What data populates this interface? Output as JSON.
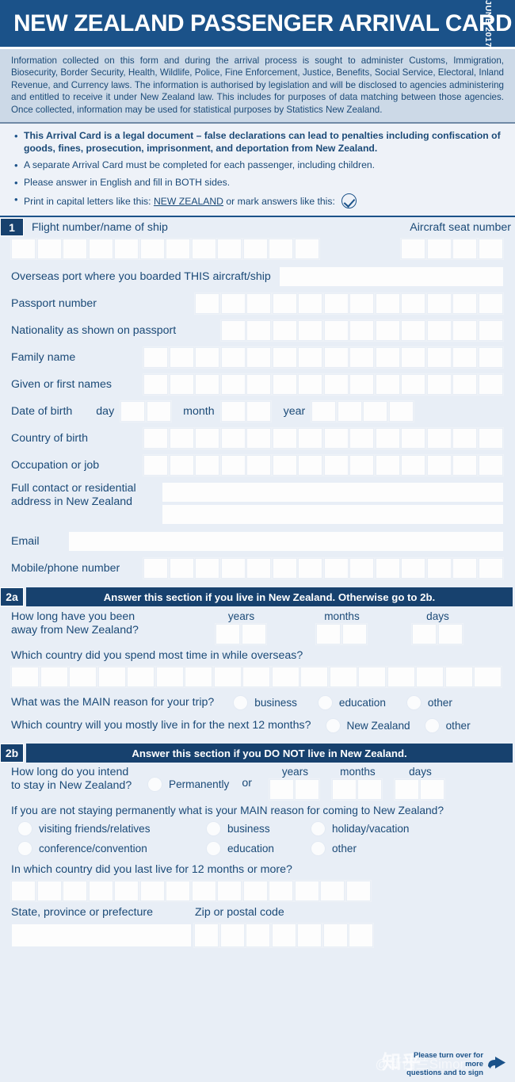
{
  "header": {
    "title": "NEW ZEALAND PASSENGER ARRIVAL CARD",
    "date": "JUNE 2017",
    "bg_color": "#1b5289"
  },
  "intro": {
    "text": "Information collected on this form and during the arrival process is sought to administer Customs, Immigration, Biosecurity, Border Security, Health, Wildlife, Police, Fine Enforcement, Justice, Benefits, Social Service, Electoral, Inland Revenue, and Currency laws. The information is authorised by legislation and will be disclosed to agencies administering and entitled to receive it under New Zealand law. This includes for purposes of data matching between those agencies. Once collected, information may be used for statistical purposes by Statistics New Zealand."
  },
  "bullets": [
    {
      "text": "This Arrival Card is a legal document – false declarations can lead to penalties including confiscation of goods, fines, prosecution, imprisonment, and deportation from New Zealand.",
      "bold": true
    },
    {
      "text": "A separate Arrival Card must be completed for each passenger, including children.",
      "bold": false
    },
    {
      "text": "Please answer in English and fill in BOTH sides.",
      "bold": false
    }
  ],
  "bullet_print": {
    "prefix": "Print in capital letters like this:",
    "example": "NEW ZEALAND",
    "suffix": "or mark answers like this:"
  },
  "section1": {
    "number": "1",
    "flight_label": "Flight number/name of ship",
    "seat_label": "Aircraft seat number",
    "flight_boxes": 12,
    "seat_boxes": 4,
    "overseas_port_label": "Overseas port where you boarded THIS aircraft/ship",
    "passport_label": "Passport number",
    "passport_boxes": 12,
    "nationality_label": "Nationality as shown on passport",
    "nationality_boxes": 11,
    "family_name_label": "Family name",
    "family_name_boxes": 14,
    "given_names_label": "Given or first names",
    "given_names_boxes": 14,
    "dob_label": "Date of birth",
    "dob_day_label": "day",
    "dob_day_boxes": 2,
    "dob_month_label": "month",
    "dob_month_boxes": 2,
    "dob_year_label": "year",
    "dob_year_boxes": 4,
    "country_birth_label": "Country of birth",
    "country_birth_boxes": 14,
    "occupation_label": "Occupation or job",
    "occupation_boxes": 14,
    "address_label_line1": "Full contact or residential",
    "address_label_line2": "address in New Zealand",
    "email_label": "Email",
    "mobile_label": "Mobile/phone number",
    "mobile_boxes": 14
  },
  "section2a": {
    "number": "2a",
    "title": "Answer this section if you live in New Zealand. Otherwise go to 2b.",
    "away_label_line1": "How long have you been",
    "away_label_line2": "away from New Zealand?",
    "years_label": "years",
    "months_label": "months",
    "days_label": "days",
    "years_boxes": 2,
    "months_boxes": 2,
    "days_boxes": 2,
    "most_time_label": "Which country did you spend most time in while overseas?",
    "most_time_boxes": 17,
    "main_reason_label": "What was the MAIN reason for your trip?",
    "main_reason_options": [
      "business",
      "education",
      "other"
    ],
    "next12_label": "Which country will you mostly live in for the next 12 months?",
    "next12_options": [
      "New Zealand",
      "other"
    ]
  },
  "section2b": {
    "number": "2b",
    "title": "Answer this section if you DO NOT live in New Zealand.",
    "stay_label_line1": "How long do you intend",
    "stay_label_line2": "to stay in New Zealand?",
    "permanently_label": "Permanently",
    "or_label": "or",
    "years_label": "years",
    "months_label": "months",
    "days_label": "days",
    "years_boxes": 2,
    "months_boxes": 2,
    "days_boxes": 2,
    "reason_label": "If you are not staying permanently what is your MAIN reason for coming to New Zealand?",
    "reason_options_col1": [
      "visiting friends/relatives",
      "conference/convention"
    ],
    "reason_options_col2": [
      "business",
      "education"
    ],
    "reason_options_col3": [
      "holiday/vacation",
      "other"
    ],
    "last_live_label": "In which country did you last live for 12 months or more?",
    "last_live_boxes": 14,
    "state_label": "State, province or prefecture",
    "zip_label": "Zip or postal code",
    "zip_boxes": 7
  },
  "footer": {
    "turnover_line1": "Please turn over for more",
    "turnover_line2": "questions and to sign",
    "watermark": "知乎",
    "watermark2": "@新西兰Simon"
  }
}
